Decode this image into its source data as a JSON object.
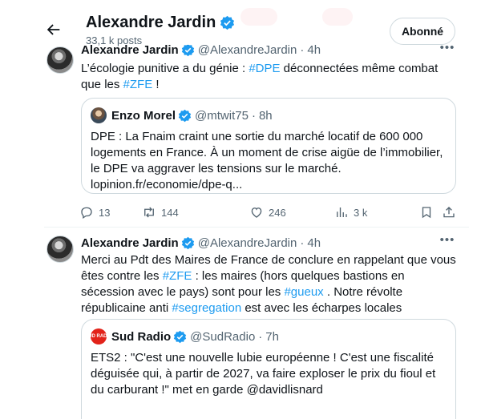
{
  "header": {
    "title": "Alexandre Jardin",
    "post_count": "33,1 k posts",
    "follow_button": "Abonné"
  },
  "tweets": [
    {
      "author": "Alexandre Jardin",
      "handle": "@AlexandreJardin",
      "time": "4h",
      "text": [
        {
          "t": "L’écologie punitive a du génie : "
        },
        {
          "t": "#DPE",
          "tag": true
        },
        {
          "t": " déconnectées même combat que les "
        },
        {
          "t": "#ZFE",
          "tag": true
        },
        {
          "t": " !"
        }
      ],
      "quote": {
        "author": "Enzo Morel",
        "handle": "@mtwit75",
        "time": "8h",
        "text": "DPE : La Fnaim craint une sortie du marché locatif de 600 000 logements en France. À un moment de crise aigüe de l’immobilier, le DPE va aggraver les tensions sur le marché. lopinion.fr/economie/dpe-q..."
      },
      "stats": {
        "replies": "13",
        "reposts": "144",
        "likes": "246",
        "views": "3 k"
      }
    },
    {
      "author": "Alexandre Jardin",
      "handle": "@AlexandreJardin",
      "time": "4h",
      "text": [
        {
          "t": "Merci au Pdt des Maires de France de conclure en rappelant que vous êtes contre les "
        },
        {
          "t": "#ZFE",
          "tag": true
        },
        {
          "t": " : les maires (hors quelques bastions en sécession avec le pays) sont pour les "
        },
        {
          "t": "#gueux",
          "tag": true
        },
        {
          "t": " . Notre révolte républicaine anti "
        },
        {
          "t": "#segregation",
          "tag": true
        },
        {
          "t": " est avec les écharpes locales"
        }
      ],
      "quote": {
        "author": "Sud Radio",
        "handle": "@SudRadio",
        "time": "7h",
        "avatar_text": "SUD RADIO",
        "text": "ETS2 : \"C'est une nouvelle lubie européenne ! C'est une fiscalité déguisée qui, à partir de 2027, va faire exploser le prix du fioul et du carburant !\" met en garde @davidlisnard"
      }
    }
  ],
  "icons": {
    "back": "arrow-left-icon",
    "verified": "verified-badge-icon",
    "more": "more-horizontal-icon",
    "reply": "reply-icon",
    "repost": "repost-icon",
    "like": "heart-icon",
    "views": "analytics-icon",
    "bookmark": "bookmark-icon",
    "share": "share-icon"
  },
  "colors": {
    "accent": "#1d9bf0",
    "text": "#0f1419",
    "secondary": "#536471",
    "border": "#cfd9de",
    "sud_radio": "#e2231a"
  }
}
